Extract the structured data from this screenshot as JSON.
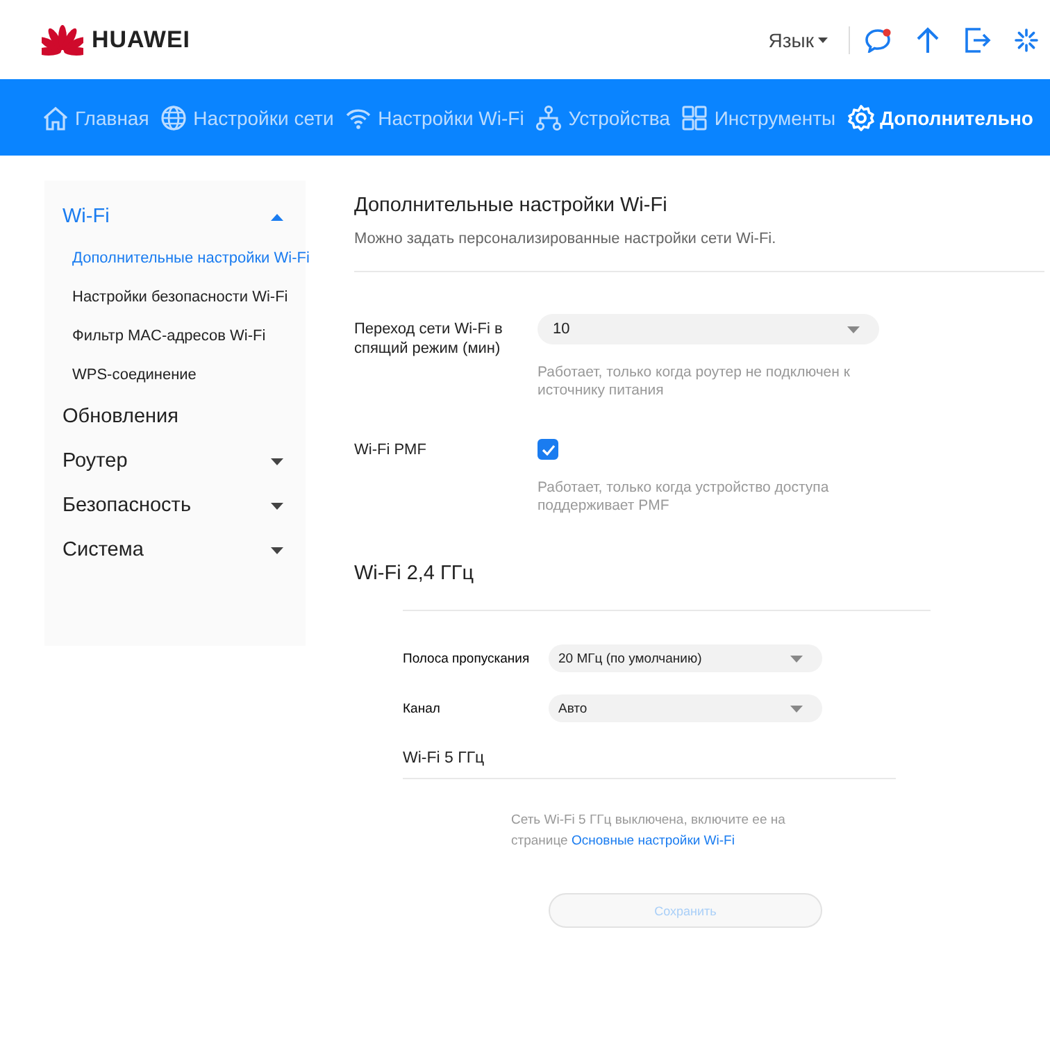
{
  "header": {
    "logo": "HUAWEI",
    "language": "Язык"
  },
  "nav": [
    {
      "label": "Главная",
      "selected": false
    },
    {
      "label": "Настройки сети",
      "selected": false
    },
    {
      "label": "Настройки Wi-Fi",
      "selected": false
    },
    {
      "label": "Устройства",
      "selected": false
    },
    {
      "label": "Инструменты",
      "selected": false
    },
    {
      "label": "Дополнительно",
      "selected": true
    }
  ],
  "sidebar": [
    {
      "label": "Wi-Fi",
      "expanded": true,
      "children": [
        {
          "label": "Дополнительные настройки Wi-Fi",
          "selected": true
        },
        {
          "label": "Настройки безопасности Wi-Fi",
          "selected": false
        },
        {
          "label": "Фильтр MAC-адресов Wi-Fi",
          "selected": false
        },
        {
          "label": "WPS-соединение",
          "selected": false
        }
      ]
    },
    {
      "label": "Обновления"
    },
    {
      "label": "Роутер",
      "expanded": false
    },
    {
      "label": "Безопасность",
      "expanded": false
    },
    {
      "label": "Система",
      "expanded": false
    }
  ],
  "page": {
    "title": "Дополнительные настройки Wi-Fi",
    "subtitle": "Можно задать персонализированные настройки сети Wi-Fi."
  },
  "settings": [
    {
      "kind": "select",
      "label": "Переход сети Wi-Fi в спящий режим (мин)",
      "value": "10",
      "hint": "Работает, только когда роутер не подключен к источнику питания"
    },
    {
      "kind": "checkbox",
      "label": "Wi-Fi PMF",
      "checked": true,
      "hint": "Работает, только когда устройство доступа поддерживает PMF"
    }
  ],
  "band_24": {
    "title": "Wi-Fi 2,4 ГГц",
    "settings": [
      {
        "kind": "select",
        "label": "Полоса пропускания",
        "value": "20 МГц (по умолчанию)"
      },
      {
        "kind": "select",
        "label": "Канал",
        "value": "Авто"
      }
    ]
  },
  "band_5": {
    "title": "Wi-Fi 5 ГГц",
    "note": "Сеть Wi-Fi 5 ГГц выключена, включите ее на странице",
    "note_link": "Основные настройки Wi-Fi"
  },
  "save_button": {
    "label": "Сохранить",
    "disabled": true
  }
}
